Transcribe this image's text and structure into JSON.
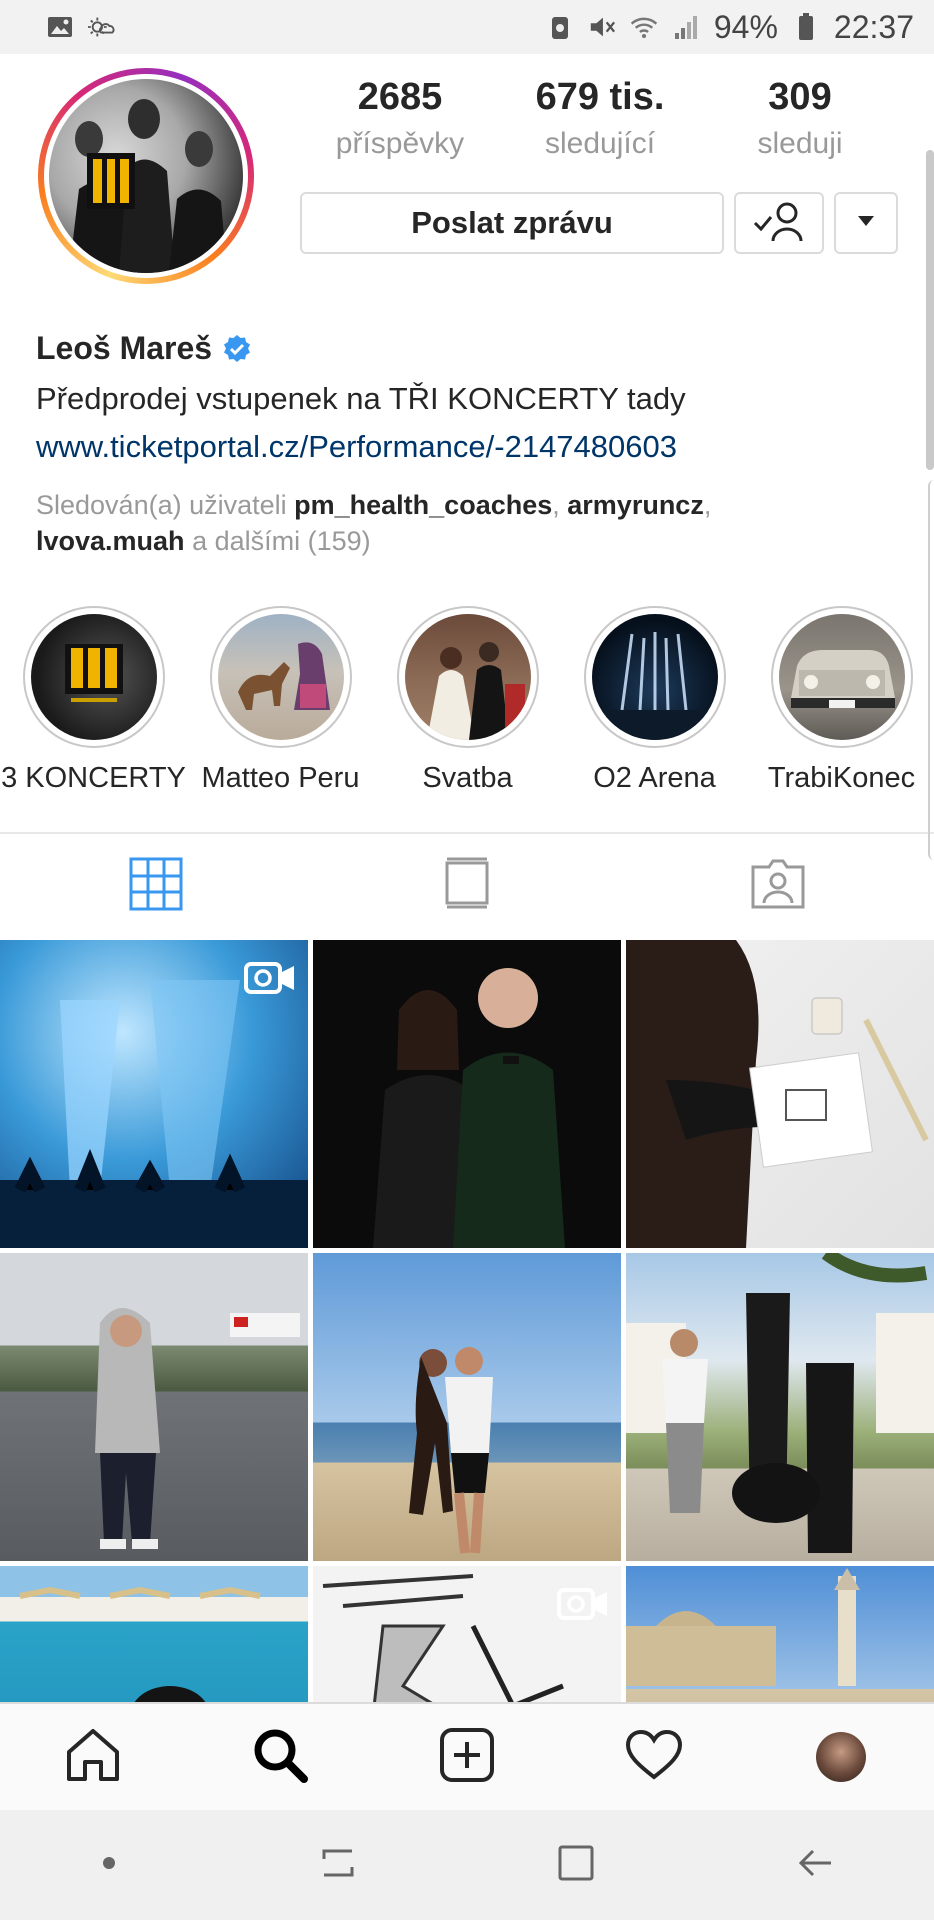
{
  "status_bar": {
    "battery": "94%",
    "time": "22:37"
  },
  "profile": {
    "stats": [
      {
        "value": "2685",
        "label": "příspěvky"
      },
      {
        "value": "679 tis.",
        "label": "sledující"
      },
      {
        "value": "309",
        "label": "sleduji"
      }
    ],
    "message_button": "Poslat zprávu",
    "name": "Leoš Mareš",
    "bio": "Předprodej vstupenek na TŘI KONCERTY tady",
    "link": "www.ticketportal.cz/Performance/-2147480603",
    "followed_by": {
      "prefix": "Sledován(a) uživateli ",
      "user1": "pm_health_coaches",
      "sep1": ", ",
      "user2": "armyruncz",
      "sep2": ",",
      "user3": "lvova.muah",
      "suffix": " a dalšími (159)"
    }
  },
  "highlights": [
    {
      "label": "3 KONCERTY"
    },
    {
      "label": "Matteo Peru"
    },
    {
      "label": "Svatba"
    },
    {
      "label": "O2 Arena"
    },
    {
      "label": "TrabiKonec"
    }
  ],
  "colors": {
    "accent": "#3897f0",
    "link": "#003569",
    "muted": "#999999",
    "active_tab": "#3897f0"
  },
  "tabs": [
    "grid-icon",
    "feed-icon",
    "tagged-icon"
  ],
  "nav": [
    "home-icon",
    "search-icon",
    "add-icon",
    "heart-icon",
    "profile-avatar"
  ]
}
